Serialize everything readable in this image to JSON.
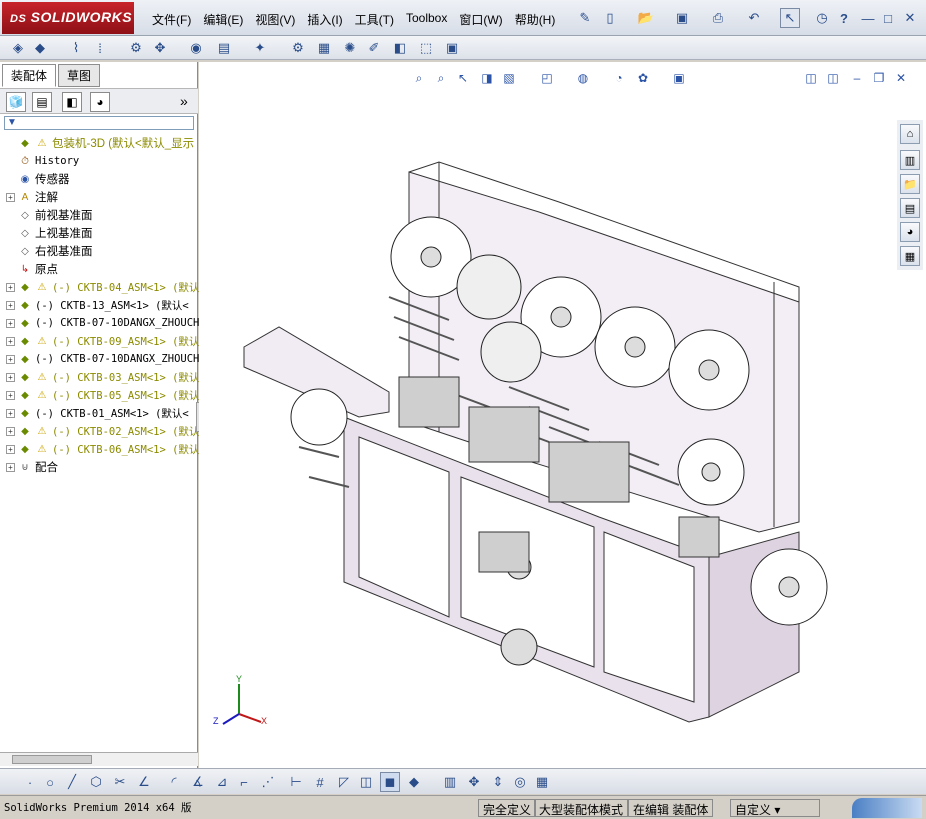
{
  "app": {
    "logo_text": "SOLIDWORKS"
  },
  "menu": [
    "文件(F)",
    "编辑(E)",
    "视图(V)",
    "插入(I)",
    "工具(T)",
    "Toolbox",
    "窗口(W)",
    "帮助(H)"
  ],
  "window_controls": {
    "minimize": "—",
    "restore": "□",
    "close": "✕",
    "help": "?"
  },
  "panel": {
    "tabs": [
      "装配体",
      "草图"
    ],
    "expand_arrows": "»",
    "filter_icon": "▼",
    "tree": [
      {
        "label": "包装机-3D  (默认<默认_显示",
        "warn": true,
        "expand": false,
        "kind": "root"
      },
      {
        "label": "History",
        "expand": false,
        "kind": "history"
      },
      {
        "label": "传感器",
        "expand": false,
        "kind": "sensor"
      },
      {
        "label": "注解",
        "expand": true,
        "kind": "annotation"
      },
      {
        "label": "前视基准面",
        "expand": false,
        "kind": "plane"
      },
      {
        "label": "上视基准面",
        "expand": false,
        "kind": "plane"
      },
      {
        "label": "右视基准面",
        "expand": false,
        "kind": "plane"
      },
      {
        "label": "原点",
        "expand": false,
        "kind": "origin"
      },
      {
        "label": "(-) CKTB-04_ASM<1> (默认",
        "warn": true,
        "expand": true,
        "kind": "asm"
      },
      {
        "label": "(-) CKTB-13_ASM<1> (默认<",
        "warn": false,
        "expand": true,
        "kind": "asm"
      },
      {
        "label": "(-) CKTB-07-10DANGX_ZHOUCH",
        "warn": false,
        "expand": true,
        "kind": "asm"
      },
      {
        "label": "(-) CKTB-09_ASM<1> (默认",
        "warn": true,
        "expand": true,
        "kind": "asm"
      },
      {
        "label": "(-) CKTB-07-10DANGX_ZHOUCH",
        "warn": false,
        "expand": true,
        "kind": "asm"
      },
      {
        "label": "(-) CKTB-03_ASM<1> (默认",
        "warn": true,
        "expand": true,
        "kind": "asm"
      },
      {
        "label": "(-) CKTB-05_ASM<1> (默认",
        "warn": true,
        "expand": true,
        "kind": "asm"
      },
      {
        "label": "(-) CKTB-01_ASM<1> (默认<",
        "warn": false,
        "expand": true,
        "kind": "asm"
      },
      {
        "label": "(-) CKTB-02_ASM<1> (默认",
        "warn": true,
        "expand": true,
        "kind": "asm"
      },
      {
        "label": "(-) CKTB-06_ASM<1> (默认",
        "warn": true,
        "expand": true,
        "kind": "asm"
      },
      {
        "label": "配合",
        "expand": true,
        "kind": "mates"
      }
    ]
  },
  "triad": {
    "x": "X",
    "y": "Y",
    "z": "Z"
  },
  "status": {
    "product": "SolidWorks Premium 2014 x64 版",
    "defined": "完全定义",
    "mode": "大型装配体模式",
    "editing": "在编辑 装配体",
    "custom": "自定义"
  },
  "colors": {
    "accent": "#c8242b",
    "tree_warn": "#caa300",
    "component_text": "#8b8b00",
    "model_fill": "#e9e2ec"
  }
}
